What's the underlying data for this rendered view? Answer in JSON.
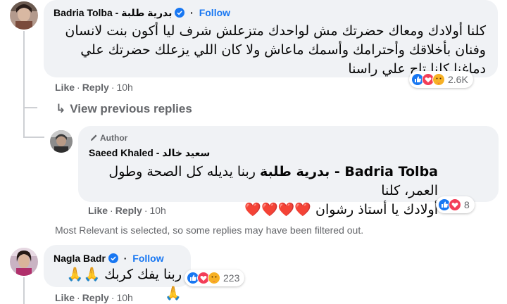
{
  "comments": [
    {
      "author": "Badria Tolba - بدرية طلبة",
      "verified": true,
      "follow_label": "Follow",
      "text_lines": [
        "كلنا أولادك ومعاك حضرتك مش لواحدك متزعلش شرف ليا أكون بنت لانسان",
        "وفنان بأخلاقك وأحترامك وأسمك ماعاش ولا كان اللي يزعلك حضرتك علي",
        "دماغنا كلنا تاج علي راسنا"
      ],
      "like_label": "Like",
      "reply_label": "Reply",
      "time": "10h",
      "reaction_icons": [
        "like-icon",
        "love-icon",
        "care-icon"
      ],
      "reaction_count": "2.6K"
    },
    {
      "author": "Nagla Badr",
      "verified": true,
      "follow_label": "Follow",
      "text": "ربنا يفك كربك 🙏🙏🙏",
      "like_label": "Like",
      "reply_label": "Reply",
      "time": "10h",
      "reaction_icons": [
        "like-icon",
        "love-icon",
        "care-icon"
      ],
      "reaction_count": "223"
    }
  ],
  "view_previous_replies": "View previous replies",
  "reply": {
    "badge": "Author",
    "author": "Saeed Khaled - سعيد خالد",
    "mention": "Badria Tolba - بدرية طلبة",
    "text_line1_rest": "ربنا يديله كل الصحة وطول العمر، كلنا",
    "text_line2": "أولادك يا أستاذ رشوان ❤️❤️❤️❤️",
    "like_label": "Like",
    "reply_label": "Reply",
    "time": "10h",
    "reaction_icons": [
      "like-icon",
      "love-icon"
    ],
    "reaction_count": "8"
  },
  "filter_note": "Most Relevant is selected, so some replies may have been filtered out.",
  "colors": {
    "accent": "#1877f2",
    "bubble": "#f0f2f5",
    "muted": "#65676b"
  }
}
